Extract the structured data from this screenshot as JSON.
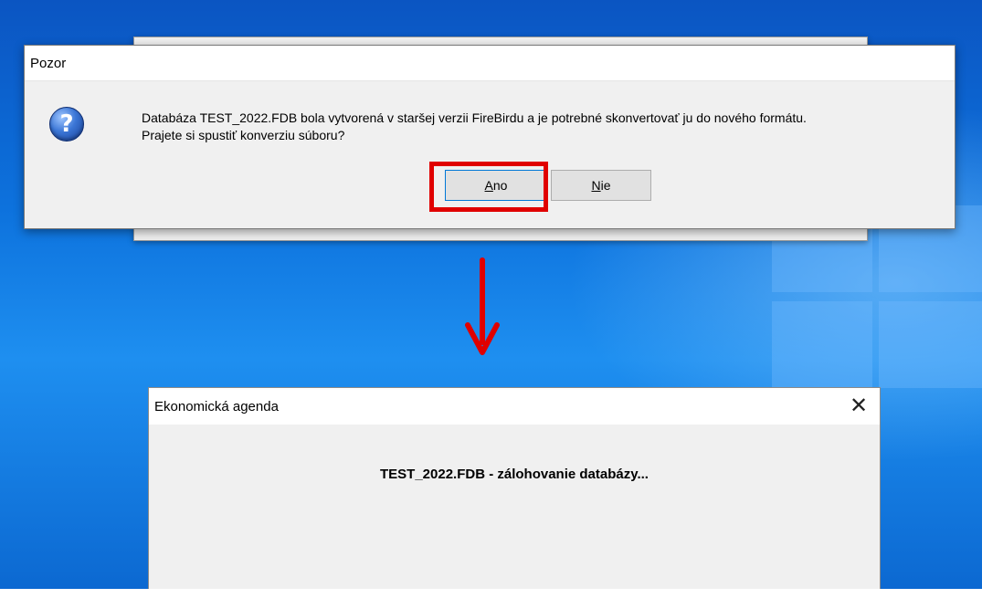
{
  "dialog": {
    "title": "Pozor",
    "message_line1": "Databáza TEST_2022.FDB bola vytvorená v staršej verzii FireBirdu a je potrebné skonvertovať ju do nového formátu.",
    "message_line2": "Prajete si spustiť konverziu súboru?",
    "icon": "question-icon",
    "buttons": {
      "yes_rest": "no",
      "yes_access": "A",
      "no_access": "N",
      "no_rest": "ie"
    }
  },
  "progress_window": {
    "title": "Ekonomická agenda",
    "message": "TEST_2022.FDB - zálohovanie databázy...",
    "close_glyph": "✕"
  },
  "colors": {
    "highlight": "#e00000",
    "desktop": "#0a6fd6"
  }
}
